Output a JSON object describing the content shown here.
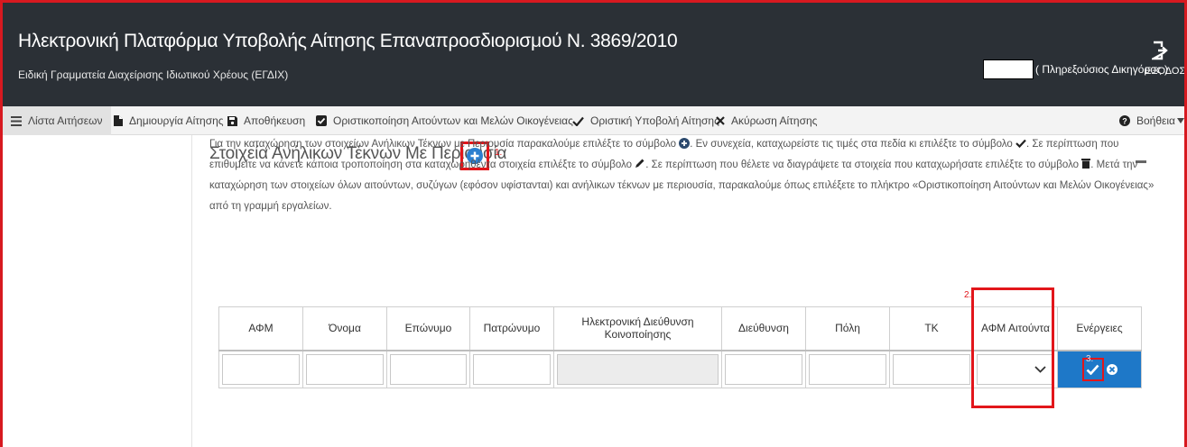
{
  "header": {
    "title": "Ηλεκτρονική Πλατφόρμα Υποβολής Αίτησης Επαναπροσδιορισμού Ν. 3869/2010",
    "subtitle": "Ειδική Γραμματεία Διαχείρισης Ιδιωτικού Χρέους (ΕΓΔΙΧ)",
    "user_role": "( Πληρεξούσιος Δικηγόρος )",
    "logout_label": "ΕΞΟΔΟΣ"
  },
  "toolbar": {
    "items": [
      {
        "label": "Λίστα Αιτήσεων",
        "icon": "list-icon"
      },
      {
        "label": "Δημιουργία Αίτησης",
        "icon": "file-icon"
      },
      {
        "label": "Αποθήκευση",
        "icon": "save-icon"
      },
      {
        "label": "Οριστικοποίηση Αιτούντων και Μελών Οικογένειας",
        "icon": "checkbox-icon"
      },
      {
        "label": "Οριστική Υποβολή Αίτησης",
        "icon": "check-icon"
      },
      {
        "label": "Ακύρωση Αίτησης",
        "icon": "close-icon"
      }
    ],
    "help_label": "Βοήθεια"
  },
  "section": {
    "title": "Στοιχεία Ανήλικων Τέκνων Με Περιουσία",
    "step_1": "1.",
    "step_2": "2.",
    "step_3": "3.",
    "instructions_1": "Για την καταχώρηση των στοιχείων Ανήλικων Τέκνων με Περιουσία παρακαλούμε επιλέξτε το σύμβολο ",
    "instructions_2": ". Εν συνεχεία, καταχωρείστε τις τιμές στα πεδία κι επιλέξτε το σύμβολο ",
    "instructions_3": ". Σε περίπτωση που επιθυμείτε να κάνετε κάποια τροποποίηση στα καταχωρηθέντα στοιχεία επιλέξτε το σύμβολο ",
    "instructions_4": ". Σε περίπτωση που θέλετε να διαγράψετε τα στοιχεία που καταχωρήσατε επιλέξτε το σύμβολο ",
    "instructions_5": ". Μετά την καταχώρηση των στοιχείων όλων αιτούντων, συζύγων (εφόσον υφίστανται) και ανήλικων τέκνων με περιουσία, παρακαλούμε όπως επιλέξετε το πλήκτρο «Οριστικοποίηση Αιτούντων και Μελών Οικογένειας» από τη γραμμή εργαλείων."
  },
  "table": {
    "columns": [
      "ΑΦΜ",
      "Όνομα",
      "Επώνυμο",
      "Πατρώνυμο",
      "Ηλεκτρονική Διεύθυνση Κοινοποίησης",
      "Διεύθυνση",
      "Πόλη",
      "ΤΚ",
      "ΑΦΜ Αιτούντα",
      "Ενέργειες"
    ]
  },
  "colors": {
    "header_bg": "#2b3036",
    "accent_blue": "#1e78c8",
    "annotation_red": "#e2161b"
  }
}
